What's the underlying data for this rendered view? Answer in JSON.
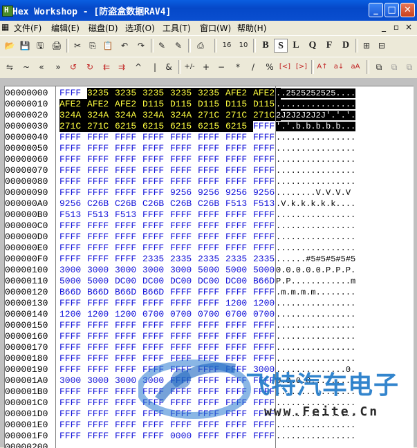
{
  "window": {
    "title": "Hex Workshop - [防盗盒数据RAV4]",
    "icon_letter": "H",
    "minimize_glyph": "_",
    "maximize_glyph": "□",
    "close_glyph": "✕"
  },
  "menu": {
    "items": [
      "文件(F)",
      "编辑(E)",
      "磁盘(D)",
      "选项(O)",
      "工具(T)",
      "窗口(W)",
      "帮助(H)"
    ],
    "mdi_min": "_",
    "mdi_restore": "▫",
    "mdi_close": "×"
  },
  "toolbar1": {
    "buttons": [
      "📂",
      "💾",
      "🖫",
      "🖨",
      "✂",
      "⎘",
      "📋",
      "↶",
      "↷",
      "✎",
      "✎",
      "⎙",
      "16",
      "10",
      "B",
      "S",
      "L",
      "Q",
      "F",
      "D",
      "⊞",
      "⊟"
    ]
  },
  "toolbar2": {
    "buttons": [
      "⇋",
      "~",
      "«",
      "»",
      "↺",
      "↻",
      "⇇",
      "⇉",
      "^",
      "|",
      "&",
      "+/-",
      "+",
      "−",
      "*",
      "/",
      "%",
      "[<]",
      "[>]",
      "A↑",
      "a↓",
      "aA",
      "⧉",
      "⧉",
      "⧉"
    ]
  },
  "hex": {
    "offsets": [
      "00000000",
      "00000010",
      "00000020",
      "00000030",
      "00000040",
      "00000050",
      "00000060",
      "00000070",
      "00000080",
      "00000090",
      "000000A0",
      "000000B0",
      "000000C0",
      "000000D0",
      "000000E0",
      "000000F0",
      "00000100",
      "00000110",
      "00000120",
      "00000130",
      "00000140",
      "00000150",
      "00000160",
      "00000170",
      "00000180",
      "00000190",
      "000001A0",
      "000001B0",
      "000001C0",
      "000001D0",
      "000001E0",
      "000001F0",
      "00000200"
    ],
    "rows": [
      [
        "FFFF",
        "3235",
        "3235",
        "3235",
        "3235",
        "3235",
        "AFE2",
        "AFE2"
      ],
      [
        "AFE2",
        "AFE2",
        "AFE2",
        "D115",
        "D115",
        "D115",
        "D115",
        "D115"
      ],
      [
        "324A",
        "324A",
        "324A",
        "324A",
        "324A",
        "271C",
        "271C",
        "271C"
      ],
      [
        "271C",
        "271C",
        "6215",
        "6215",
        "6215",
        "6215",
        "6215",
        "FFFF"
      ],
      [
        "FFFF",
        "FFFF",
        "FFFF",
        "FFFF",
        "FFFF",
        "FFFF",
        "FFFF",
        "FFFF"
      ],
      [
        "FFFF",
        "FFFF",
        "FFFF",
        "FFFF",
        "FFFF",
        "FFFF",
        "FFFF",
        "FFFF"
      ],
      [
        "FFFF",
        "FFFF",
        "FFFF",
        "FFFF",
        "FFFF",
        "FFFF",
        "FFFF",
        "FFFF"
      ],
      [
        "FFFF",
        "FFFF",
        "FFFF",
        "FFFF",
        "FFFF",
        "FFFF",
        "FFFF",
        "FFFF"
      ],
      [
        "FFFF",
        "FFFF",
        "FFFF",
        "FFFF",
        "FFFF",
        "FFFF",
        "FFFF",
        "FFFF"
      ],
      [
        "FFFF",
        "FFFF",
        "FFFF",
        "FFFF",
        "9256",
        "9256",
        "9256",
        "9256"
      ],
      [
        "9256",
        "C26B",
        "C26B",
        "C26B",
        "C26B",
        "C26B",
        "F513",
        "F513"
      ],
      [
        "F513",
        "F513",
        "F513",
        "FFFF",
        "FFFF",
        "FFFF",
        "FFFF",
        "FFFF"
      ],
      [
        "FFFF",
        "FFFF",
        "FFFF",
        "FFFF",
        "FFFF",
        "FFFF",
        "FFFF",
        "FFFF"
      ],
      [
        "FFFF",
        "FFFF",
        "FFFF",
        "FFFF",
        "FFFF",
        "FFFF",
        "FFFF",
        "FFFF"
      ],
      [
        "FFFF",
        "FFFF",
        "FFFF",
        "FFFF",
        "FFFF",
        "FFFF",
        "FFFF",
        "FFFF"
      ],
      [
        "FFFF",
        "FFFF",
        "FFFF",
        "2335",
        "2335",
        "2335",
        "2335",
        "2335"
      ],
      [
        "3000",
        "3000",
        "3000",
        "3000",
        "3000",
        "5000",
        "5000",
        "5000"
      ],
      [
        "5000",
        "5000",
        "DC00",
        "DC00",
        "DC00",
        "DC00",
        "DC00",
        "B66D"
      ],
      [
        "B66D",
        "B66D",
        "B66D",
        "B66D",
        "FFFF",
        "FFFF",
        "FFFF",
        "FFFF"
      ],
      [
        "FFFF",
        "FFFF",
        "FFFF",
        "FFFF",
        "FFFF",
        "FFFF",
        "1200",
        "1200"
      ],
      [
        "1200",
        "1200",
        "1200",
        "0700",
        "0700",
        "0700",
        "0700",
        "0700"
      ],
      [
        "FFFF",
        "FFFF",
        "FFFF",
        "FFFF",
        "FFFF",
        "FFFF",
        "FFFF",
        "FFFF"
      ],
      [
        "FFFF",
        "FFFF",
        "FFFF",
        "FFFF",
        "FFFF",
        "FFFF",
        "FFFF",
        "FFFF"
      ],
      [
        "FFFF",
        "FFFF",
        "FFFF",
        "FFFF",
        "FFFF",
        "FFFF",
        "FFFF",
        "FFFF"
      ],
      [
        "FFFF",
        "FFFF",
        "FFFF",
        "FFFF",
        "FFFF",
        "FFFF",
        "FFFF",
        "FFFF"
      ],
      [
        "FFFF",
        "FFFF",
        "FFFF",
        "FFFF",
        "FFFF",
        "FFFF",
        "FFFF",
        "3000"
      ],
      [
        "3000",
        "3000",
        "3000",
        "3000",
        "FFFF",
        "FFFF",
        "FFFF",
        "FFFF"
      ],
      [
        "FFFF",
        "FFFF",
        "FFFF",
        "FFFF",
        "FFFF",
        "FFFF",
        "FFFF",
        "FFFF"
      ],
      [
        "FFFF",
        "FFFF",
        "FFFF",
        "FFFF",
        "FFFF",
        "FFFF",
        "FFFF",
        "FFFF"
      ],
      [
        "FFFF",
        "FFFF",
        "FFFF",
        "FFFF",
        "FFFF",
        "FFFF",
        "FFFF",
        "FFFF"
      ],
      [
        "FFFF",
        "FFFF",
        "FFFF",
        "FFFF",
        "FFFF",
        "FFFF",
        "FFFF",
        "FFFF"
      ],
      [
        "FFFF",
        "FFFF",
        "FFFF",
        "FFFF",
        "0000",
        "FFFF",
        "FFFF",
        "FFFF"
      ]
    ],
    "ascii": [
      "..2525252525....",
      "................",
      "2J2J2J2J2J'.'.'.",
      "'.'.b.b.b.b.b...",
      "................",
      "................",
      "................",
      "................",
      "................",
      "........V.V.V.V",
      ".V.k.k.k.k.k....",
      "................",
      "................",
      "................",
      "................",
      "......#5#5#5#5#5",
      "0.0.0.0.0.P.P.P.",
      "P.P............m",
      ".m.m.m.m........",
      "................",
      "................",
      "................",
      "................",
      "................",
      "................",
      "..............0.",
      "0.0.0.0.........",
      "................",
      "................",
      "................",
      "................",
      "................"
    ]
  },
  "watermark": {
    "brand_cn": "飞特汽车电子",
    "url": "www.Feite.Cn"
  },
  "colors": {
    "hex_text": "#1010d8",
    "selection_bg": "#000000",
    "selection_hex_text": "#ffff40",
    "titlebar": "#0548c8"
  }
}
